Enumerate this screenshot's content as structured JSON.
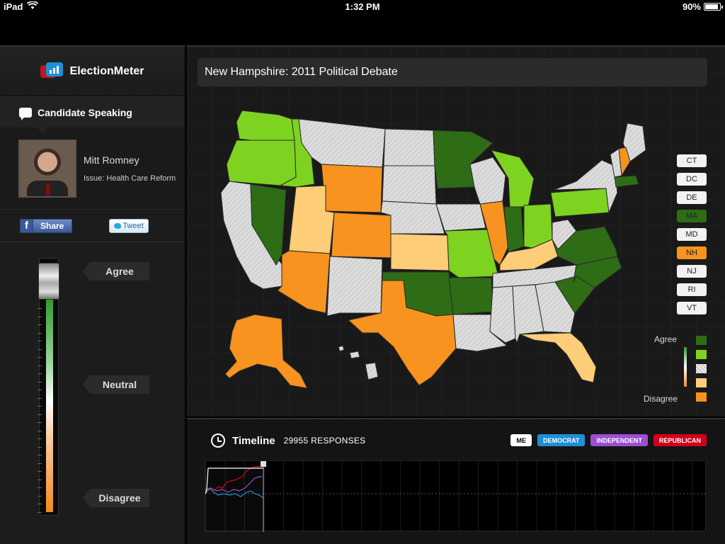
{
  "status_bar": {
    "device": "iPad",
    "time": "1:32 PM",
    "battery": "90%",
    "battery_level": 0.9
  },
  "brand": {
    "name": "ElectionMeter"
  },
  "speaking": {
    "header": "Candidate Speaking",
    "candidate_name": "Mitt Romney",
    "issue": "Issue: Health Care Reform"
  },
  "social": {
    "share_label": "Share",
    "tweet_label": "Tweet"
  },
  "meter": {
    "agree": "Agree",
    "neutral": "Neutral",
    "disagree": "Disagree",
    "level": 1.0
  },
  "main": {
    "title": "New Hampshire: 2011 Political Debate"
  },
  "small_states": [
    {
      "code": "CT",
      "color": "#f2f2f2",
      "text": "#222"
    },
    {
      "code": "DC",
      "color": "#f2f2f2",
      "text": "#222"
    },
    {
      "code": "DE",
      "color": "#f2f2f2",
      "text": "#222"
    },
    {
      "code": "MA",
      "color": "#2e6d16",
      "text": "#222"
    },
    {
      "code": "MD",
      "color": "#f2f2f2",
      "text": "#222"
    },
    {
      "code": "NH",
      "color": "#f7931e",
      "text": "#222"
    },
    {
      "code": "NJ",
      "color": "#f2f2f2",
      "text": "#222"
    },
    {
      "code": "RI",
      "color": "#f2f2f2",
      "text": "#222"
    },
    {
      "code": "VT",
      "color": "#f2f2f2",
      "text": "#222"
    }
  ],
  "legend": {
    "agree_label": "Agree",
    "disagree_label": "Disagree",
    "swatches": [
      "#2e6d16",
      "#7ed321",
      "#e5e5e5",
      "#fdd17a",
      "#f7931e"
    ]
  },
  "colors": {
    "strong_agree": "#2e6d16",
    "agree": "#7ed321",
    "neutral": "#dcdcdc",
    "disagree": "#fdcd77",
    "strong_disagree": "#f7931e"
  },
  "timeline": {
    "title": "Timeline",
    "responses": "29955 RESPONSES",
    "parties": [
      {
        "label": "ME",
        "color": "#ffffff",
        "text": "#000000"
      },
      {
        "label": "DEMOCRAT",
        "color": "#1e8fd6",
        "text": "#ffffff"
      },
      {
        "label": "INDEPENDENT",
        "color": "#9b4fd1",
        "text": "#ffffff"
      },
      {
        "label": "REPUBLICAN",
        "color": "#d0021b",
        "text": "#ffffff"
      }
    ]
  }
}
